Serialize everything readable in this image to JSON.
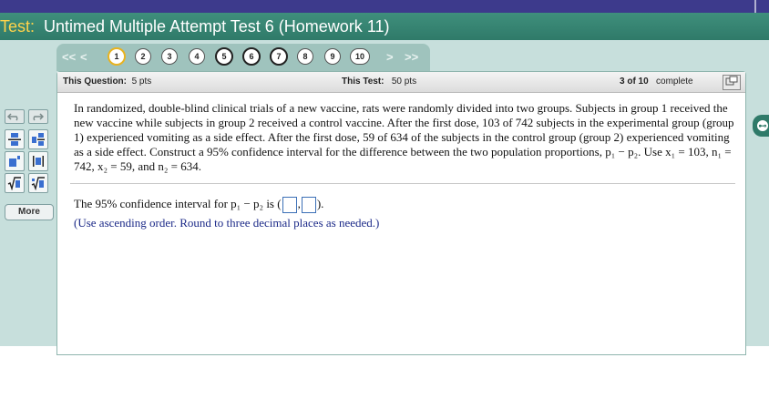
{
  "title": {
    "label": "Test:",
    "name": "Untimed Multiple Attempt Test 6 (Homework 11)"
  },
  "nav": {
    "first_symbol": "<<",
    "prev_symbol": "<",
    "next_symbol": ">",
    "last_symbol": ">>",
    "questions": [
      "1",
      "2",
      "3",
      "4",
      "5",
      "6",
      "7",
      "8",
      "9",
      "10"
    ]
  },
  "info": {
    "question_label": "This Question:",
    "question_pts": "5 pts",
    "test_label": "This Test:",
    "test_pts": "50 pts",
    "progress_count": "3 of 10",
    "progress_status": "complete"
  },
  "question_text": "In randomized, double-blind clinical trials of a new vaccine, rats were randomly divided into two groups. Subjects in group 1 received the new vaccine while subjects in group 2 received a control vaccine. After the first dose, 103 of 742 subjects in the experimental group (group 1) experienced vomiting as a side effect. After the first dose, 59 of 634 of the subjects in the control group (group 2) experienced vomiting as a side effect. Construct a 95% confidence interval for the difference between the two population proportions, p₁ − p₂. Use x₁ = 103, n₁ = 742, x₂ = 59, and n₂ = 634.",
  "answer": {
    "prefix": "The 95% confidence interval for p₁ − p₂ is (",
    "separator": ",",
    "suffix": ")."
  },
  "hint": "(Use ascending order. Round to three decimal places as needed.)",
  "palette": {
    "more_label": "More"
  },
  "colors": {
    "header": "#2f7a69",
    "title_label": "#ffd34a",
    "workspace": "#c7dfdc",
    "hint_text": "#1c2a88"
  }
}
